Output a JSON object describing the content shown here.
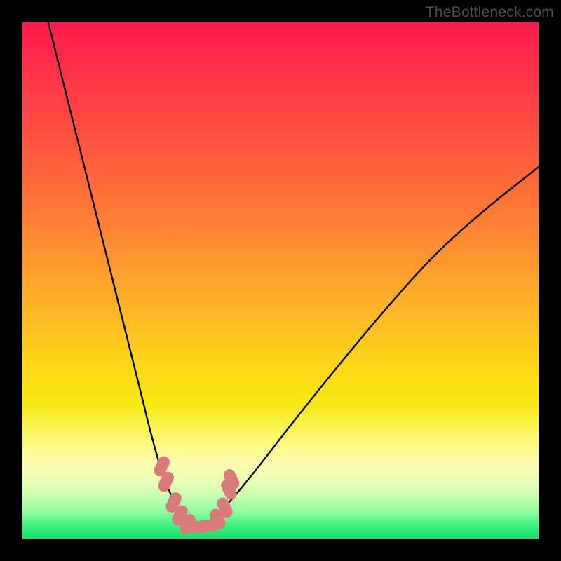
{
  "watermark": "TheBottleneck.com",
  "colors": {
    "curve": "#000000",
    "marker_fill": "#d97a7d",
    "marker_stroke": "#c86a6e",
    "frame": "#000000"
  },
  "chart_data": {
    "type": "line",
    "title": "",
    "xlabel": "",
    "ylabel": "",
    "xlim": [
      0,
      100
    ],
    "ylim": [
      0,
      100
    ],
    "grid": false,
    "legend": false,
    "note": "Values are estimated from pixel positions; y is percentage (0 at bottom, 100 at top). Curve is a V-shaped bottleneck chart with minimum near x≈33.",
    "series": [
      {
        "name": "bottleneck-curve",
        "x": [
          5,
          8,
          12,
          16,
          20,
          23,
          25,
          27,
          29,
          31,
          33,
          35,
          37,
          40,
          45,
          52,
          60,
          70,
          80,
          90,
          100
        ],
        "y": [
          100,
          88,
          72,
          56,
          40,
          28,
          20,
          13,
          8,
          4,
          2,
          2,
          4,
          7,
          13,
          22,
          32,
          44,
          55,
          64,
          72
        ]
      }
    ],
    "markers": {
      "name": "highlight-points",
      "note": "Pink rounded markers near the trough of the curve",
      "points": [
        {
          "x": 27.0,
          "y": 14.0
        },
        {
          "x": 27.8,
          "y": 11.0
        },
        {
          "x": 29.3,
          "y": 7.0
        },
        {
          "x": 30.5,
          "y": 4.5
        },
        {
          "x": 32.0,
          "y": 2.8
        },
        {
          "x": 34.0,
          "y": 2.2
        },
        {
          "x": 36.0,
          "y": 2.5
        },
        {
          "x": 37.8,
          "y": 3.8
        },
        {
          "x": 39.2,
          "y": 6.0
        },
        {
          "x": 40.0,
          "y": 9.5
        },
        {
          "x": 40.5,
          "y": 11.5
        }
      ]
    }
  }
}
